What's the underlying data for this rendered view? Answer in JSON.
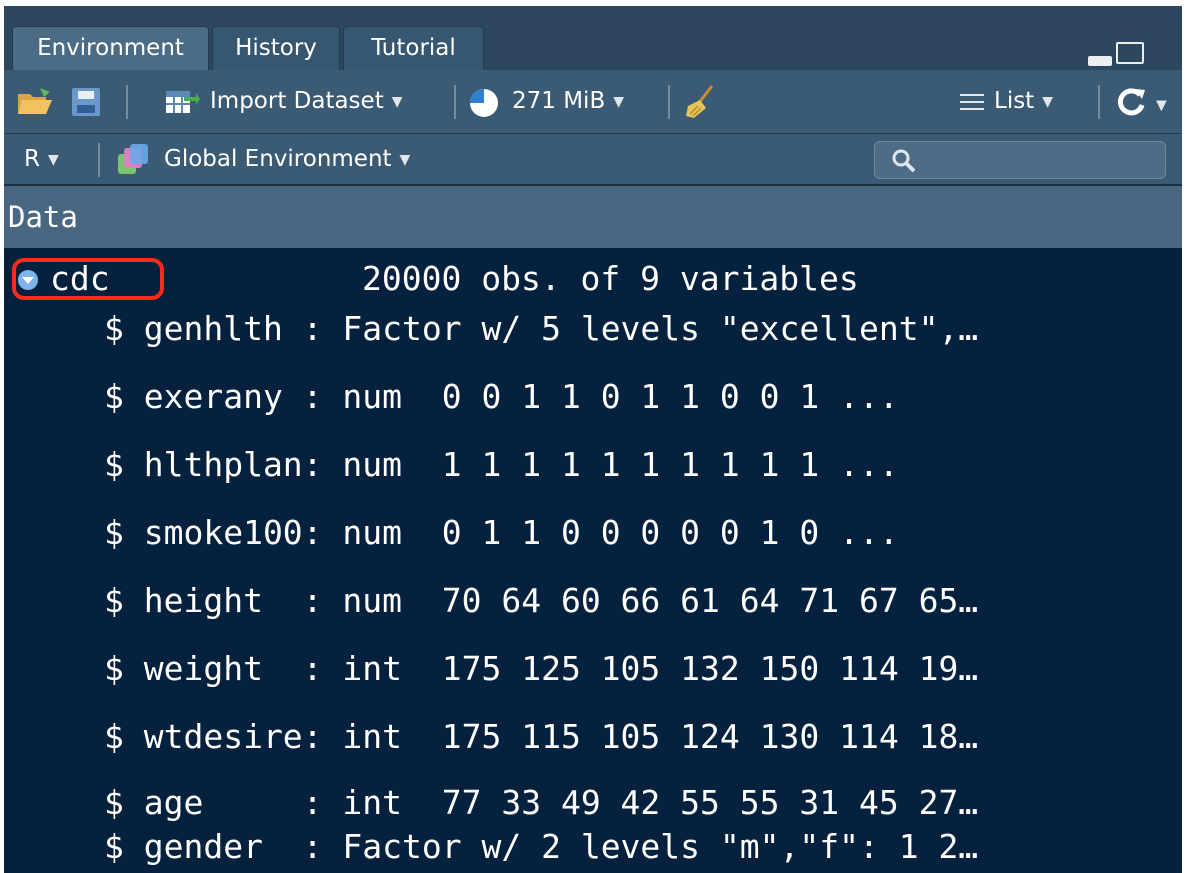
{
  "tabs": [
    {
      "label": "Environment",
      "active": true
    },
    {
      "label": "History",
      "active": false
    },
    {
      "label": "Tutorial",
      "active": false
    }
  ],
  "toolbar": {
    "import_label": "Import Dataset",
    "memory_label": "271 MiB",
    "view_label": "List",
    "language_label": "R",
    "environment_label": "Global Environment",
    "search_placeholder": ""
  },
  "section": {
    "title": "Data"
  },
  "object": {
    "name": "cdc",
    "description": "20000 obs. of 9 variables"
  },
  "variables": [
    "$ genhlth : Factor w/ 5 levels \"excellent\",…",
    "$ exerany : num  0 0 1 1 0 1 1 0 0 1 ...",
    "$ hlthplan: num  1 1 1 1 1 1 1 1 1 1 ...",
    "$ smoke100: num  0 1 1 0 0 0 0 0 1 0 ...",
    "$ height  : num  70 64 60 66 61 64 71 67 65…",
    "$ weight  : int  175 125 105 132 150 114 19…",
    "$ wtdesire: int  175 115 105 124 130 114 18…",
    "$ age     : int  77 33 49 42 55 55 31 45 27…",
    "$ gender  : Factor w/ 2 levels \"m\",\"f\": 1 2…"
  ],
  "colors": {
    "pane_bg": "#05213d",
    "toolbar_bg": "#3b5a74",
    "highlight": "#ff2a1a"
  }
}
